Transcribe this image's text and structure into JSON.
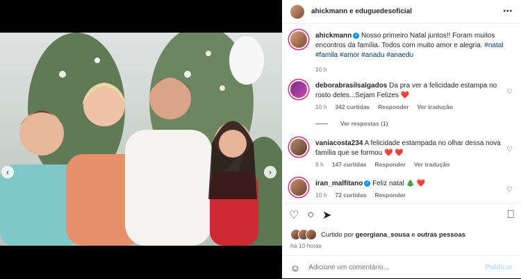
{
  "header": {
    "usernames": "ahickmann e eduguedesoficial",
    "more_label": "•••"
  },
  "caption": {
    "username": "ahickmann",
    "text": "Nosso primeiro Natal juntos!! Foram muitos encontros da família. Todos com muito amor e alegria.",
    "tags": "#natal #famila #amor #anadu #anaedu",
    "time": "10 h"
  },
  "comments": [
    {
      "username": "deborabrasilsalgados",
      "text": "Da pra ver a felicidade estampa no rosto deles...Sejam Felizes",
      "emoji": "❤️",
      "time": "10 h",
      "likes": "342 curtidas",
      "reply": "Responder",
      "translate": "Ver tradução",
      "view_replies": "Ver respostas (1)"
    },
    {
      "username": "vaniacosta234",
      "text": "A felicidade estampada no olhar dessa nova família que se formou",
      "emoji": "❤️ ❤️",
      "time": "9 h",
      "likes": "147 curtidas",
      "reply": "Responder",
      "translate": "Ver tradução"
    },
    {
      "username": "iran_malfitano",
      "text": "Feliz natal",
      "emoji": "🎄 ❤️",
      "time": "10 h",
      "likes": "72 curtidas",
      "reply": "Responder"
    }
  ],
  "likes": {
    "prefix": "Curtido por",
    "user": "georgiana_sousa",
    "middle": "e",
    "others": "outras pessoas"
  },
  "post_time": "há 10 horas",
  "add_comment": {
    "placeholder": "Adicione um comentário...",
    "publish": "Publicar"
  },
  "carousel": {
    "prev": "‹",
    "next": "›"
  },
  "colors": {
    "link": "#00376b",
    "verified": "#0095f6",
    "publish": "#b2dffc"
  }
}
